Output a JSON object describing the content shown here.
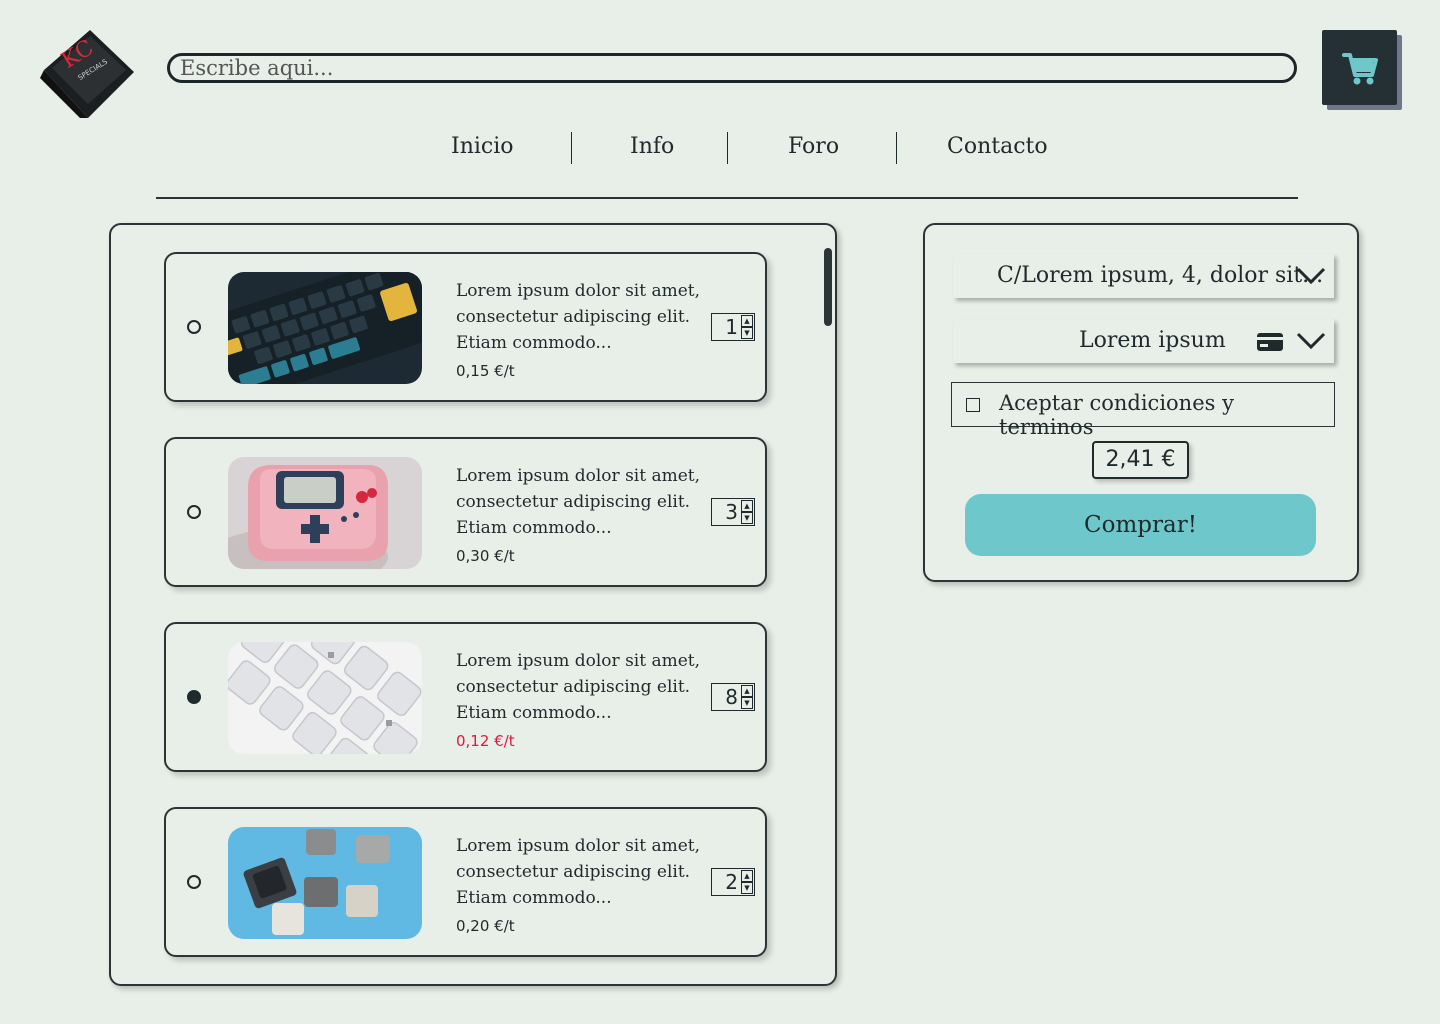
{
  "brand": {
    "logo_line1": "KC",
    "logo_line2": "SPECIALS"
  },
  "search": {
    "placeholder": "Escribe aqui..."
  },
  "nav": [
    "Inicio",
    "Info",
    "Foro",
    "Contacto"
  ],
  "products": [
    {
      "desc": "Lorem ipsum dolor sit amet, consectetur adipiscing elit. Etiam commodo...",
      "price": "0,15 €/t",
      "qty": "1",
      "selected": false
    },
    {
      "desc": "Lorem ipsum dolor sit amet, consectetur adipiscing elit. Etiam commodo...",
      "price": "0,30 €/t",
      "qty": "3",
      "selected": false
    },
    {
      "desc": "Lorem ipsum dolor sit amet, consectetur adipiscing elit. Etiam commodo...",
      "price": "0,12 €/t",
      "qty": "8",
      "selected": true
    },
    {
      "desc": "Lorem ipsum dolor sit amet, consectetur adipiscing elit. Etiam commodo...",
      "price": "0,20 €/t",
      "qty": "2",
      "selected": false
    }
  ],
  "order": {
    "address": "C/Lorem ipsum, 4, dolor sit...",
    "payment": "Lorem ipsum",
    "terms": "Aceptar condiciones y terminos",
    "total": "2,41 €",
    "buy": "Comprar!"
  },
  "colors": {
    "accent": "#6ec7cb",
    "sale": "#e0183c",
    "dark": "#243033"
  }
}
